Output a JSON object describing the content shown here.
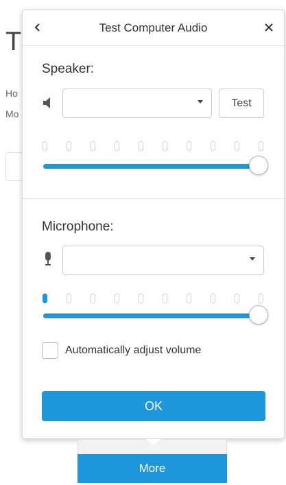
{
  "background": {
    "title_fragment": "T",
    "line1_fragment": "Ho",
    "line2_fragment": "Mo"
  },
  "dialog": {
    "title": "Test Computer Audio",
    "back_icon": "chevron-left-icon",
    "close_icon": "close-icon"
  },
  "speaker": {
    "label": "Speaker:",
    "icon": "speaker-icon",
    "selected_value": "",
    "test_label": "Test",
    "level_bars_lit": 0,
    "level_bars_total": 10,
    "volume_percent": 100
  },
  "microphone": {
    "label": "Microphone:",
    "icon": "microphone-icon",
    "selected_value": "",
    "level_bars_lit": 1,
    "level_bars_total": 10,
    "volume_percent": 100,
    "auto_adjust_label": "Automatically adjust volume",
    "auto_adjust_checked": false
  },
  "ok_label": "OK",
  "more_label": "More",
  "colors": {
    "accent": "#1e96dc"
  }
}
